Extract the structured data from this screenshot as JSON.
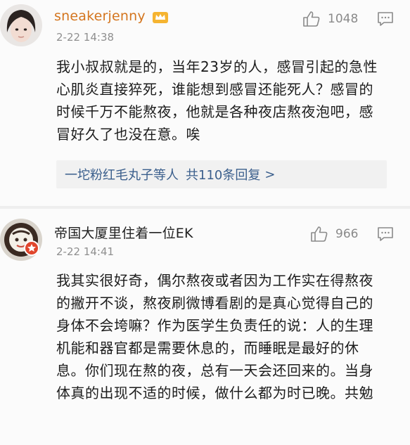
{
  "comments": [
    {
      "username": "sneakerjenny",
      "timestamp": "2-22 14:38",
      "likes": "1048",
      "text": "我小叔叔就是的，当年23岁的人，感冒引起的急性心肌炎直接猝死，谁能想到感冒还能死人？感冒的时候千万不能熬夜，他就是各种夜店熬夜泡吧，感冒好久了也没在意。唉",
      "reply_summary": "一坨粉红毛丸子等人",
      "reply_count": "共110条回复",
      "reply_chevron": ">"
    },
    {
      "username": "帝国大厦里住着一位EK",
      "timestamp": "2-22 14:41",
      "likes": "966",
      "text": "我其实很好奇，偶尔熬夜或者因为工作实在得熬夜的撇开不谈，熬夜刷微博看剧的是真心觉得自己的身体不会垮嘛？作为医学生负责任的说：人的生理机能和器官都是需要休息的，而睡眠是最好的休息。你们现在熬的夜，总有一天会还回来的。当身体真的出现不适的时候，做什么都为时已晚。共勉"
    }
  ],
  "colors": {
    "vip_username": "#d4751e",
    "link": "#3a5e8c",
    "muted": "#8f8f8f"
  }
}
